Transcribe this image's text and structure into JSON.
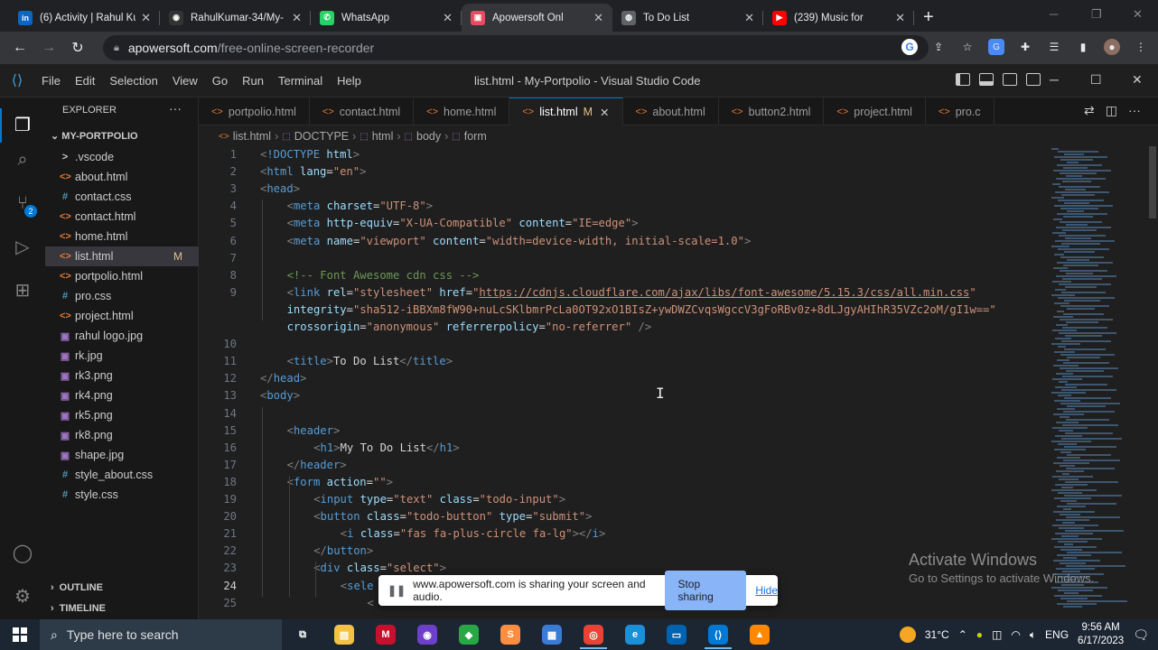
{
  "browser": {
    "tabs": [
      {
        "title": "(6) Activity | Rahul Ku",
        "icon": "linkedin-icon",
        "color": "#0a66c2",
        "glyph": "in",
        "active": false
      },
      {
        "title": "RahulKumar-34/My-",
        "icon": "github-icon",
        "color": "#333333",
        "glyph": "◉",
        "active": false
      },
      {
        "title": "WhatsApp",
        "icon": "whatsapp-icon",
        "color": "#25d366",
        "glyph": "✆",
        "active": false
      },
      {
        "title": "Apowersoft Onl",
        "icon": "apowersoft-icon",
        "color": "#e84a5f",
        "glyph": "▣",
        "active": true
      },
      {
        "title": "To Do List",
        "icon": "globe-icon",
        "color": "#5f6368",
        "glyph": "◍",
        "active": false
      },
      {
        "title": "(239) Music for",
        "icon": "youtube-icon",
        "color": "#ff0000",
        "glyph": "▶",
        "active": false
      }
    ],
    "new_tab": "+",
    "url_domain": "apowersoft.com",
    "url_path": "/free-online-screen-recorder"
  },
  "vscode": {
    "menu": [
      "File",
      "Edit",
      "Selection",
      "View",
      "Go",
      "Run",
      "Terminal",
      "Help"
    ],
    "window_title": "list.html - My-Portpolio - Visual Studio Code",
    "explorer": {
      "header": "EXPLORER",
      "project": "MY-PORTPOLIO",
      "files": [
        {
          "name": ".vscode",
          "type": "dir",
          "icon": ">",
          "selected": false,
          "mod": ""
        },
        {
          "name": "about.html",
          "type": "html",
          "icon": "<>",
          "selected": false,
          "mod": ""
        },
        {
          "name": "contact.css",
          "type": "css",
          "icon": "#",
          "selected": false,
          "mod": ""
        },
        {
          "name": "contact.html",
          "type": "html",
          "icon": "<>",
          "selected": false,
          "mod": ""
        },
        {
          "name": "home.html",
          "type": "html",
          "icon": "<>",
          "selected": false,
          "mod": ""
        },
        {
          "name": "list.html",
          "type": "html",
          "icon": "<>",
          "selected": true,
          "mod": "M"
        },
        {
          "name": "portpolio.html",
          "type": "html",
          "icon": "<>",
          "selected": false,
          "mod": ""
        },
        {
          "name": "pro.css",
          "type": "css",
          "icon": "#",
          "selected": false,
          "mod": ""
        },
        {
          "name": "project.html",
          "type": "html",
          "icon": "<>",
          "selected": false,
          "mod": ""
        },
        {
          "name": "rahul logo.jpg",
          "type": "img",
          "icon": "▣",
          "selected": false,
          "mod": ""
        },
        {
          "name": "rk.jpg",
          "type": "img",
          "icon": "▣",
          "selected": false,
          "mod": ""
        },
        {
          "name": "rk3.png",
          "type": "img",
          "icon": "▣",
          "selected": false,
          "mod": ""
        },
        {
          "name": "rk4.png",
          "type": "img",
          "icon": "▣",
          "selected": false,
          "mod": ""
        },
        {
          "name": "rk5.png",
          "type": "img",
          "icon": "▣",
          "selected": false,
          "mod": ""
        },
        {
          "name": "rk8.png",
          "type": "img",
          "icon": "▣",
          "selected": false,
          "mod": ""
        },
        {
          "name": "shape.jpg",
          "type": "img",
          "icon": "▣",
          "selected": false,
          "mod": ""
        },
        {
          "name": "style_about.css",
          "type": "css",
          "icon": "#",
          "selected": false,
          "mod": ""
        },
        {
          "name": "style.css",
          "type": "css",
          "icon": "#",
          "selected": false,
          "mod": ""
        }
      ],
      "outline": "OUTLINE",
      "timeline": "TIMELINE"
    },
    "scm_badge": "2",
    "editor_tabs": [
      {
        "name": "portpolio.html",
        "active": false,
        "mod": ""
      },
      {
        "name": "contact.html",
        "active": false,
        "mod": ""
      },
      {
        "name": "home.html",
        "active": false,
        "mod": ""
      },
      {
        "name": "list.html",
        "active": true,
        "mod": "M"
      },
      {
        "name": "about.html",
        "active": false,
        "mod": ""
      },
      {
        "name": "button2.html",
        "active": false,
        "mod": ""
      },
      {
        "name": "project.html",
        "active": false,
        "mod": ""
      },
      {
        "name": "pro.c",
        "active": false,
        "mod": ""
      }
    ],
    "breadcrumb": [
      "list.html",
      "DOCTYPE",
      "html",
      "body",
      "form"
    ],
    "current_line": 24,
    "code_lines": [
      {
        "n": "1",
        "i": 0,
        "s": [
          [
            "pun",
            "<"
          ],
          [
            "tag",
            "!DOCTYPE "
          ],
          [
            "attr",
            "html"
          ],
          [
            "pun",
            ">"
          ]
        ]
      },
      {
        "n": "2",
        "i": 0,
        "s": [
          [
            "pun",
            "<"
          ],
          [
            "tag",
            "html "
          ],
          [
            "attr",
            "lang"
          ],
          [
            "txt",
            "="
          ],
          [
            "str",
            "\"en\""
          ],
          [
            "pun",
            ">"
          ]
        ]
      },
      {
        "n": "3",
        "i": 0,
        "s": [
          [
            "pun",
            "<"
          ],
          [
            "tag",
            "head"
          ],
          [
            "pun",
            ">"
          ]
        ]
      },
      {
        "n": "4",
        "i": 1,
        "s": [
          [
            "pun",
            "<"
          ],
          [
            "tag",
            "meta "
          ],
          [
            "attr",
            "charset"
          ],
          [
            "txt",
            "="
          ],
          [
            "str",
            "\"UTF-8\""
          ],
          [
            "pun",
            ">"
          ]
        ]
      },
      {
        "n": "5",
        "i": 1,
        "s": [
          [
            "pun",
            "<"
          ],
          [
            "tag",
            "meta "
          ],
          [
            "attr",
            "http-equiv"
          ],
          [
            "txt",
            "="
          ],
          [
            "str",
            "\"X-UA-Compatible\" "
          ],
          [
            "attr",
            "content"
          ],
          [
            "txt",
            "="
          ],
          [
            "str",
            "\"IE=edge\""
          ],
          [
            "pun",
            ">"
          ]
        ]
      },
      {
        "n": "6",
        "i": 1,
        "s": [
          [
            "pun",
            "<"
          ],
          [
            "tag",
            "meta "
          ],
          [
            "attr",
            "name"
          ],
          [
            "txt",
            "="
          ],
          [
            "str",
            "\"viewport\" "
          ],
          [
            "attr",
            "content"
          ],
          [
            "txt",
            "="
          ],
          [
            "str",
            "\"width=device-width, initial-scale=1.0\""
          ],
          [
            "pun",
            ">"
          ]
        ]
      },
      {
        "n": "7",
        "i": 0,
        "s": []
      },
      {
        "n": "8",
        "i": 1,
        "s": [
          [
            "cmt",
            "<!-- Font Awesome cdn css -->"
          ]
        ]
      },
      {
        "n": "9",
        "i": 1,
        "s": [
          [
            "pun",
            "<"
          ],
          [
            "tag",
            "link "
          ],
          [
            "attr",
            "rel"
          ],
          [
            "txt",
            "="
          ],
          [
            "str",
            "\"stylesheet\" "
          ],
          [
            "attr",
            "href"
          ],
          [
            "txt",
            "="
          ],
          [
            "str",
            "\""
          ],
          [
            "url",
            "https://cdnjs.cloudflare.com/ajax/libs/font-awesome/5.15.3/css/all.min.css"
          ],
          [
            "str",
            "\""
          ]
        ]
      },
      {
        "n": "",
        "i": 1,
        "s": [
          [
            "attr",
            "integrity"
          ],
          [
            "txt",
            "="
          ],
          [
            "str",
            "\"sha512-iBBXm8fW90+nuLcSKlbmrPcLa0OT92xO1BIsZ+ywDWZCvqsWgccV3gFoRBv0z+8dLJgyAHIhR35VZc2oM/gI1w==\""
          ]
        ]
      },
      {
        "n": "",
        "i": 1,
        "s": [
          [
            "attr",
            "crossorigin"
          ],
          [
            "txt",
            "="
          ],
          [
            "str",
            "\"anonymous\" "
          ],
          [
            "attr",
            "referrerpolicy"
          ],
          [
            "txt",
            "="
          ],
          [
            "str",
            "\"no-referrer\" "
          ],
          [
            "pun",
            "/>"
          ]
        ]
      },
      {
        "n": "10",
        "i": 0,
        "s": []
      },
      {
        "n": "11",
        "i": 1,
        "s": [
          [
            "pun",
            "<"
          ],
          [
            "tag",
            "title"
          ],
          [
            "pun",
            ">"
          ],
          [
            "txt",
            "To Do List"
          ],
          [
            "pun",
            "</"
          ],
          [
            "tag",
            "title"
          ],
          [
            "pun",
            ">"
          ]
        ]
      },
      {
        "n": "12",
        "i": 0,
        "s": [
          [
            "pun",
            "</"
          ],
          [
            "tag",
            "head"
          ],
          [
            "pun",
            ">"
          ]
        ]
      },
      {
        "n": "13",
        "i": 0,
        "s": [
          [
            "pun",
            "<"
          ],
          [
            "tag",
            "body"
          ],
          [
            "pun",
            ">"
          ]
        ]
      },
      {
        "n": "14",
        "i": 0,
        "s": []
      },
      {
        "n": "15",
        "i": 1,
        "s": [
          [
            "pun",
            "<"
          ],
          [
            "tag",
            "header"
          ],
          [
            "pun",
            ">"
          ]
        ]
      },
      {
        "n": "16",
        "i": 2,
        "s": [
          [
            "pun",
            "<"
          ],
          [
            "tag",
            "h1"
          ],
          [
            "pun",
            ">"
          ],
          [
            "txt",
            "My To Do List"
          ],
          [
            "pun",
            "</"
          ],
          [
            "tag",
            "h1"
          ],
          [
            "pun",
            ">"
          ]
        ]
      },
      {
        "n": "17",
        "i": 1,
        "s": [
          [
            "pun",
            "</"
          ],
          [
            "tag",
            "header"
          ],
          [
            "pun",
            ">"
          ]
        ]
      },
      {
        "n": "18",
        "i": 1,
        "s": [
          [
            "pun",
            "<"
          ],
          [
            "tag",
            "form "
          ],
          [
            "attr",
            "action"
          ],
          [
            "txt",
            "="
          ],
          [
            "str",
            "\"\""
          ],
          [
            "pun",
            ">"
          ]
        ]
      },
      {
        "n": "19",
        "i": 2,
        "s": [
          [
            "pun",
            "<"
          ],
          [
            "tag",
            "input "
          ],
          [
            "attr",
            "type"
          ],
          [
            "txt",
            "="
          ],
          [
            "str",
            "\"text\" "
          ],
          [
            "attr",
            "class"
          ],
          [
            "txt",
            "="
          ],
          [
            "str",
            "\"todo-input\""
          ],
          [
            "pun",
            ">"
          ]
        ]
      },
      {
        "n": "20",
        "i": 2,
        "s": [
          [
            "pun",
            "<"
          ],
          [
            "tag",
            "button "
          ],
          [
            "attr",
            "class"
          ],
          [
            "txt",
            "="
          ],
          [
            "str",
            "\"todo-button\" "
          ],
          [
            "attr",
            "type"
          ],
          [
            "txt",
            "="
          ],
          [
            "str",
            "\"submit\""
          ],
          [
            "pun",
            ">"
          ]
        ]
      },
      {
        "n": "21",
        "i": 3,
        "s": [
          [
            "pun",
            "<"
          ],
          [
            "tag",
            "i "
          ],
          [
            "attr",
            "class"
          ],
          [
            "txt",
            "="
          ],
          [
            "str",
            "\"fas fa-plus-circle fa-lg\""
          ],
          [
            "pun",
            "></"
          ],
          [
            "tag",
            "i"
          ],
          [
            "pun",
            ">"
          ]
        ]
      },
      {
        "n": "22",
        "i": 2,
        "s": [
          [
            "pun",
            "</"
          ],
          [
            "tag",
            "button"
          ],
          [
            "pun",
            ">"
          ]
        ]
      },
      {
        "n": "23",
        "i": 2,
        "s": [
          [
            "pun",
            "<"
          ],
          [
            "tag",
            "div "
          ],
          [
            "attr",
            "class"
          ],
          [
            "txt",
            "="
          ],
          [
            "str",
            "\"select\""
          ],
          [
            "pun",
            ">"
          ]
        ]
      },
      {
        "n": "24",
        "i": 3,
        "s": [
          [
            "pun",
            "<"
          ],
          [
            "tag",
            "sele"
          ]
        ]
      },
      {
        "n": "25",
        "i": 4,
        "s": [
          [
            "pun",
            "<"
          ]
        ]
      }
    ]
  },
  "share_bar": {
    "message": "www.apowersoft.com is sharing your screen and audio.",
    "stop": "Stop sharing",
    "hide": "Hide"
  },
  "watermark": {
    "line1": "Activate Windows",
    "line2": "Go to Settings to activate Windows."
  },
  "taskbar": {
    "search_placeholder": "Type here to search",
    "apps": [
      {
        "name": "task-view-icon",
        "glyph": "⧉",
        "color": "transparent",
        "open": false
      },
      {
        "name": "file-explorer-icon",
        "glyph": "▤",
        "color": "#f3c244",
        "open": false
      },
      {
        "name": "mcafee-icon",
        "glyph": "M",
        "color": "#c8102e",
        "open": false
      },
      {
        "name": "github-desktop-icon",
        "glyph": "◉",
        "color": "#6e40c9",
        "open": false
      },
      {
        "name": "git-icon",
        "glyph": "◆",
        "color": "#27a844",
        "open": false
      },
      {
        "name": "sublime-icon",
        "glyph": "S",
        "color": "#ff8d3f",
        "open": false
      },
      {
        "name": "photos-icon",
        "glyph": "▦",
        "color": "#3a7bd5",
        "open": false
      },
      {
        "name": "chrome-icon",
        "glyph": "◎",
        "color": "#ea4335",
        "open": true
      },
      {
        "name": "edge-icon",
        "glyph": "e",
        "color": "#1b8fd8",
        "open": false
      },
      {
        "name": "remote-icon",
        "glyph": "▭",
        "color": "#0063b1",
        "open": false
      },
      {
        "name": "vscode-icon",
        "glyph": "⟨⟩",
        "color": "#0078d4",
        "open": true
      },
      {
        "name": "vlc-icon",
        "glyph": "▲",
        "color": "#ff8800",
        "open": false
      }
    ],
    "temperature": "31°C",
    "language": "ENG",
    "time": "9:56 AM",
    "date": "6/17/2023"
  }
}
